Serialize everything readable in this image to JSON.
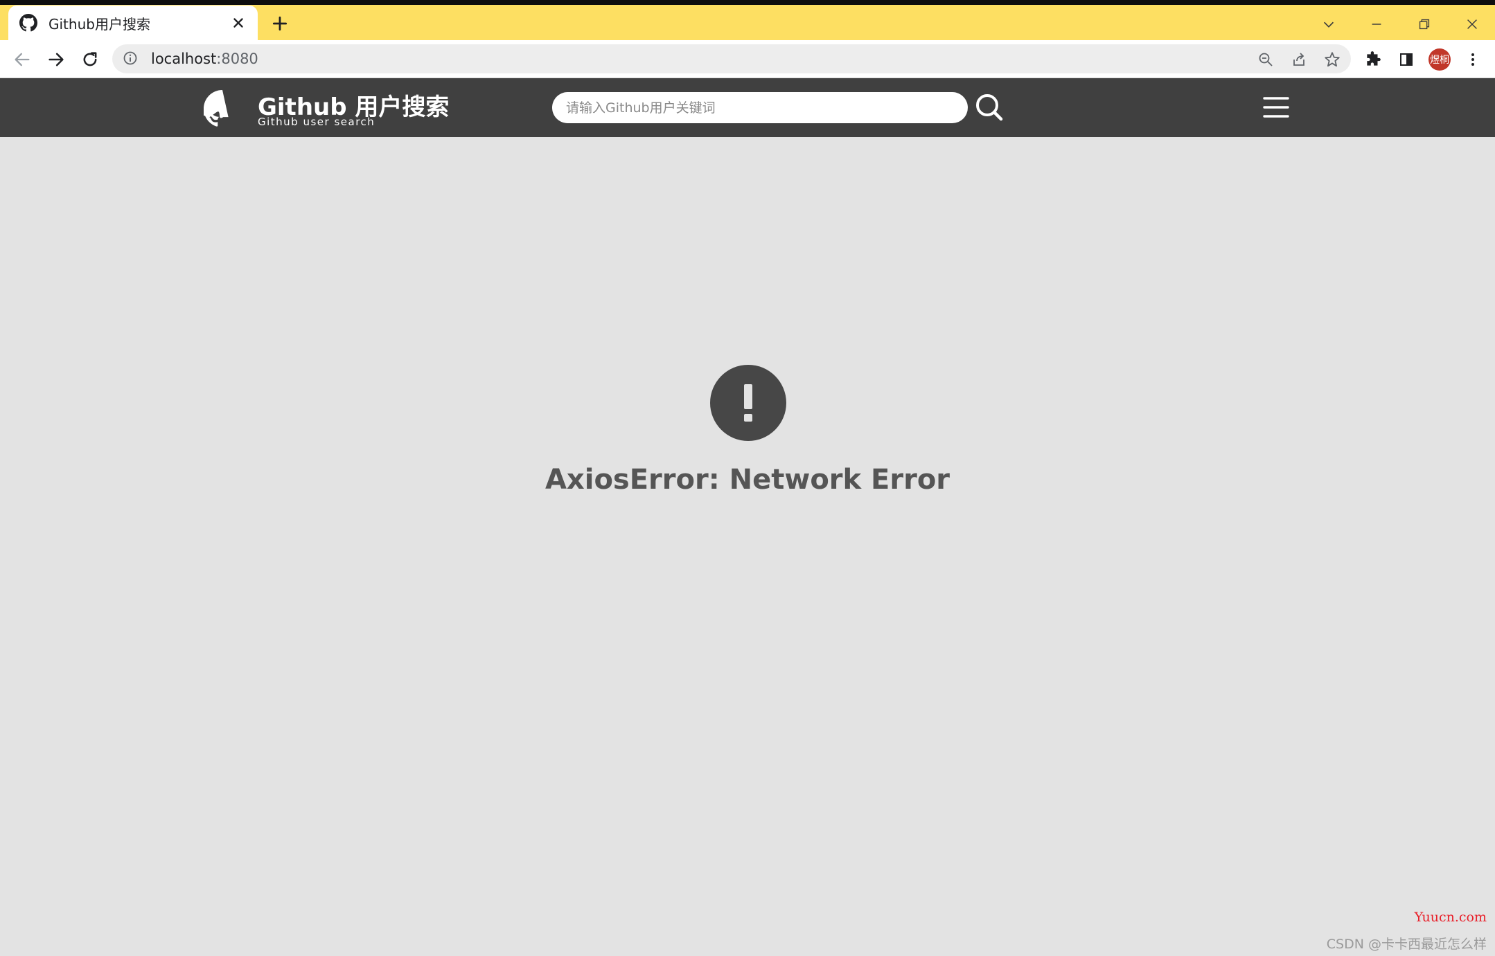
{
  "browser": {
    "tab_title": "Github用户搜索",
    "url_host": "localhost",
    "url_port": ":8080",
    "profile_label": "煜桐",
    "accent_color": "#fddf62"
  },
  "header": {
    "brand_title": "Github 用户搜索",
    "brand_subtitle": "Github user search",
    "search_placeholder": "请输入Github用户关键词",
    "background_color": "#404040"
  },
  "content": {
    "error_message": "AxiosError: Network Error"
  },
  "watermarks": {
    "site": "Yuucn.com",
    "author": "CSDN @卡卡西最近怎么样"
  }
}
